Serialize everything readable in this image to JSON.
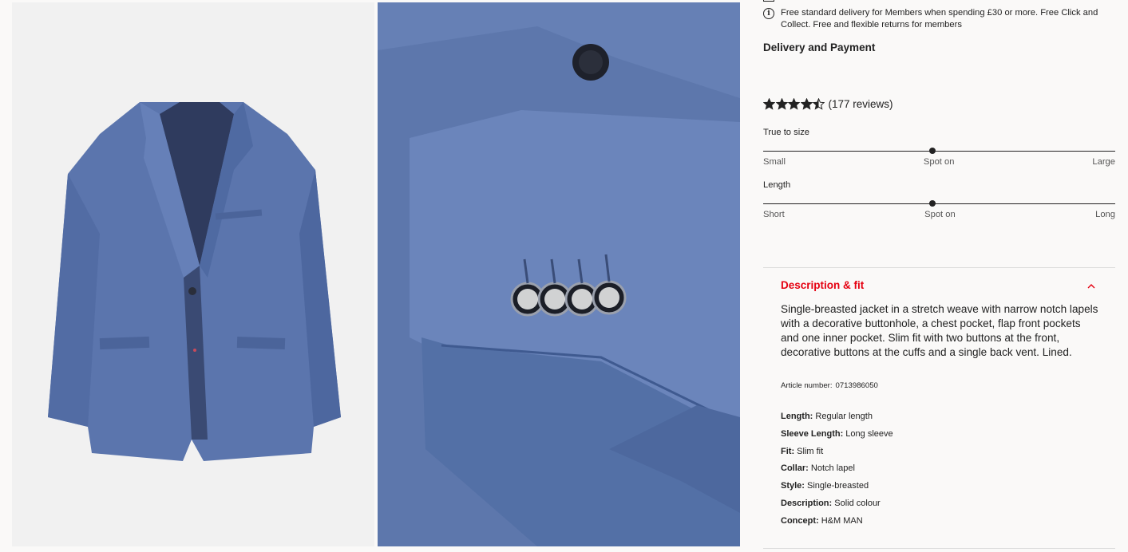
{
  "delivery": {
    "note": "Free standard delivery for Members when spending £30 or more. Free Click and Collect. Free and flexible returns for members",
    "link": "Delivery and Payment"
  },
  "rating": {
    "value": 4.5,
    "max": 5,
    "reviews": "(177 reviews)"
  },
  "fit": [
    {
      "title": "True to size",
      "left": "Small",
      "mid": "Spot on",
      "right": "Large",
      "level": 0.48
    },
    {
      "title": "Length",
      "left": "Short",
      "mid": "Spot on",
      "right": "Long",
      "level": 0.48
    }
  ],
  "description": {
    "title": "Description & fit",
    "text": "Single-breasted jacket in a stretch weave with narrow notch lapels with a decorative buttonhole, a chest pocket, flap front pockets and one inner pocket. Slim fit with two buttons at the front, decorative buttons at the cuffs and a single back vent. Lined.",
    "article_label": "Article number:",
    "article_number": "0713986050",
    "attributes": [
      {
        "label": "Length:",
        "value": "Regular length"
      },
      {
        "label": "Sleeve Length:",
        "value": "Long sleeve"
      },
      {
        "label": "Fit:",
        "value": "Slim fit"
      },
      {
        "label": "Collar:",
        "value": "Notch lapel"
      },
      {
        "label": "Style:",
        "value": "Single-breasted"
      },
      {
        "label": "Description:",
        "value": "Solid colour"
      },
      {
        "label": "Concept:",
        "value": "H&M MAN"
      }
    ]
  },
  "colors": {
    "accent": "#e50010",
    "jacket": "#5b75ad"
  }
}
